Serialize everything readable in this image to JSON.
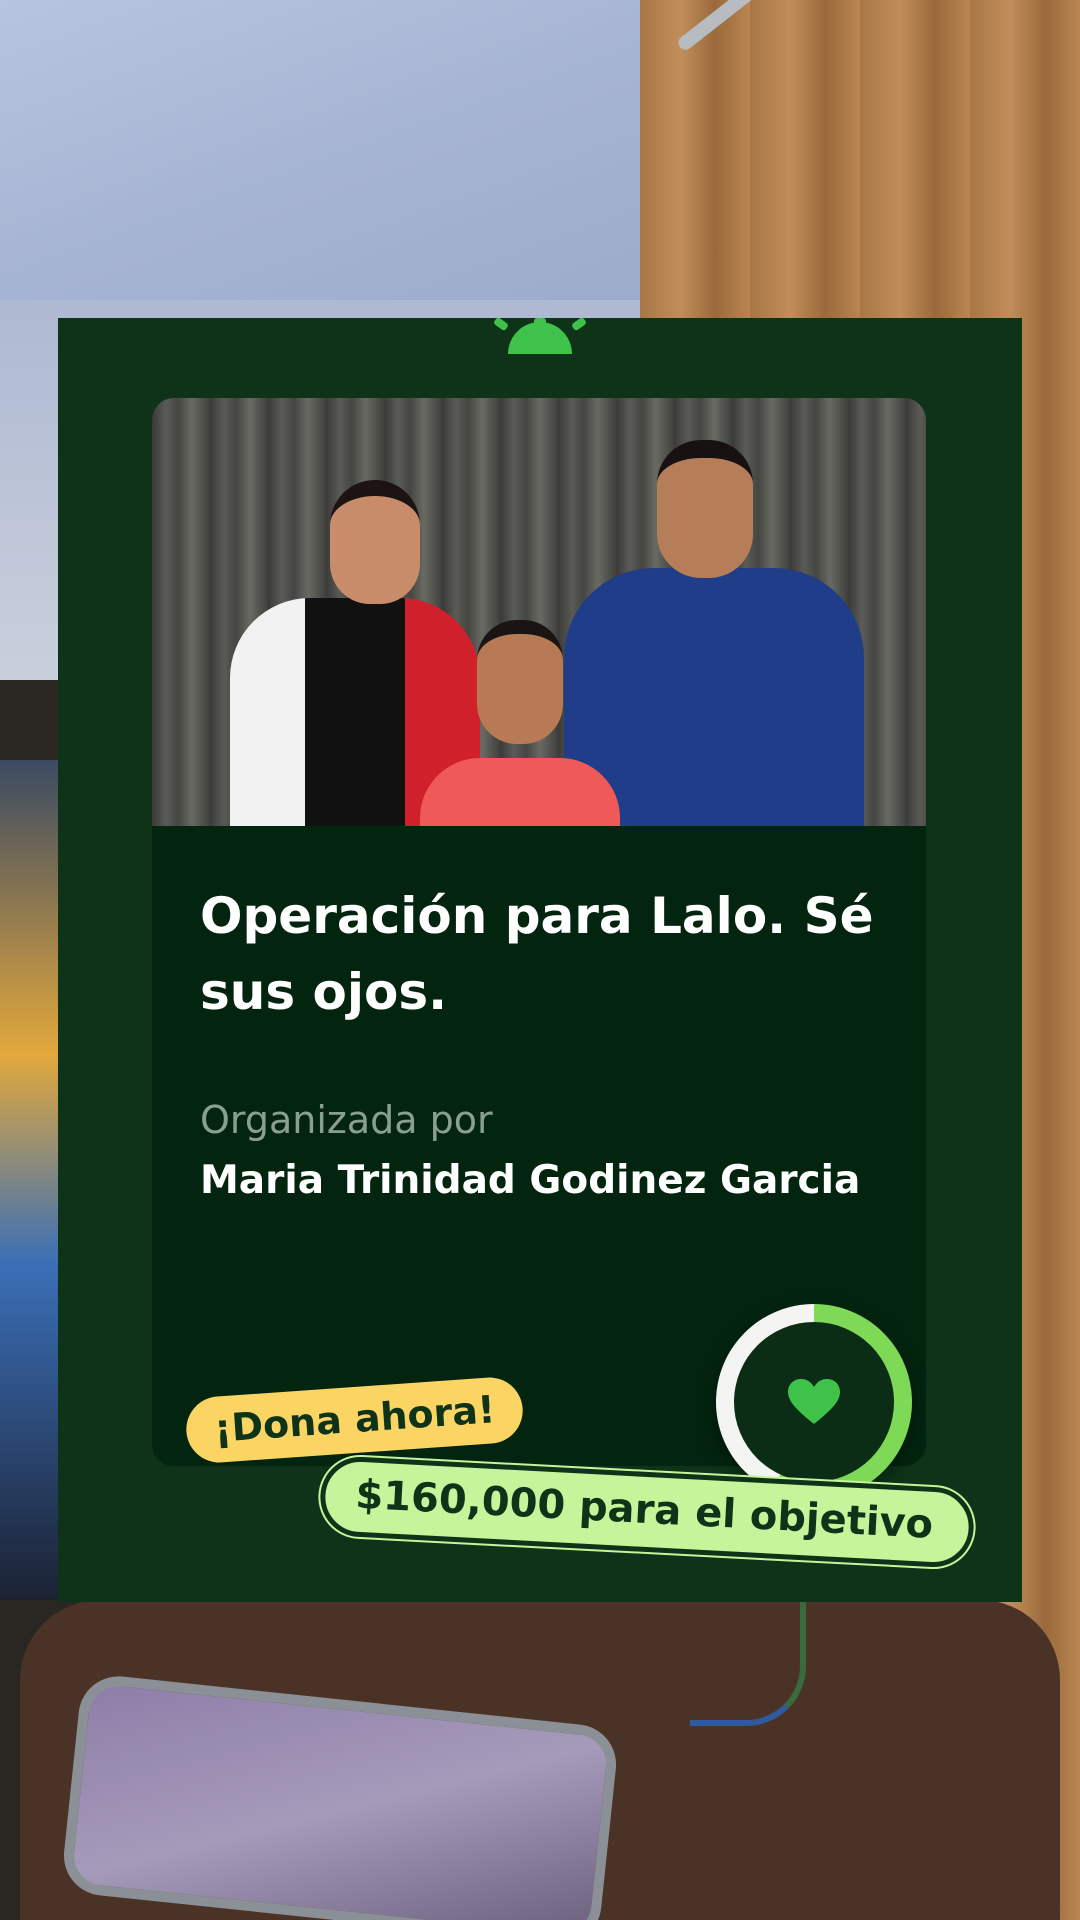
{
  "campaign": {
    "title": "Operación para Lalo. Sé sus ojos.",
    "organizer_label": "Organizada por",
    "organizer_name": "Maria Trinidad Godinez Garcia",
    "donate_label": "¡Dona ahora!",
    "goal_text": "$160,000 para el objetivo",
    "progress_fraction": 0.57
  },
  "icons": {
    "logo": "gofundme-logo-icon",
    "heart": "heart-icon"
  },
  "colors": {
    "card_background": "#0e3318",
    "inner_background": "#03240f",
    "accent_green": "#7ed957",
    "donate_yellow": "#fbd563",
    "goal_green": "#c5f59b"
  }
}
